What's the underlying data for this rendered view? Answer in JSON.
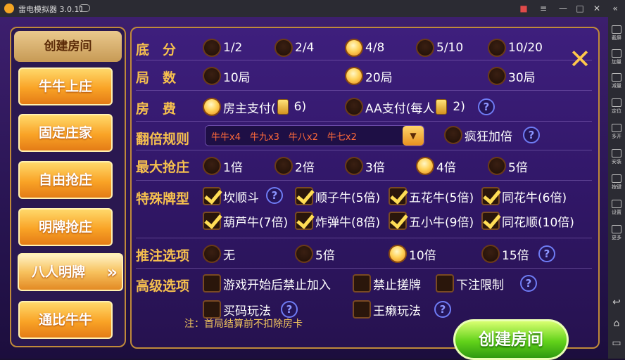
{
  "window": {
    "title": "雷电模拟器 3.0.11"
  },
  "right_sidebar": {
    "items": [
      "截屏",
      "加量",
      "减量",
      "定位",
      "多开",
      "安装",
      "按键",
      "设置",
      "更多"
    ]
  },
  "left_panel": {
    "title": "创建房间",
    "modes": [
      "牛牛上庄",
      "固定庄家",
      "自由抢庄",
      "明牌抢庄",
      "八人明牌",
      "通比牛牛"
    ],
    "active_mode": "八人明牌",
    "active_arrow": "»"
  },
  "close_glyph": "✕",
  "settings": {
    "base_score": {
      "label": "底　分",
      "options": [
        "1/2",
        "2/4",
        "4/8",
        "5/10",
        "10/20"
      ],
      "selected": "4/8"
    },
    "rounds": {
      "label": "局　数",
      "options": [
        "10局",
        "20局",
        "30局"
      ],
      "selected": "20局"
    },
    "room_fee": {
      "label": "房　费",
      "owner_pay": "房主支付(",
      "owner_cost": "6)",
      "aa_pay": "AA支付(每人",
      "aa_cost": "2)",
      "selected": "房主支付"
    },
    "double_rule": {
      "label": "翻倍规则",
      "dropdown_value": "牛牛x4　牛九x3　牛八x2　牛七x2",
      "dropdown_arrow": "▼",
      "crazy_label": "疯狂加倍"
    },
    "max_grab": {
      "label": "最大抢庄",
      "options": [
        "1倍",
        "2倍",
        "3倍",
        "4倍",
        "5倍"
      ],
      "selected": "4倍"
    },
    "special": {
      "label": "特殊牌型",
      "row1": [
        "坎顺斗",
        "顺子牛(5倍)",
        "五花牛(5倍)",
        "同花牛(6倍)"
      ],
      "row2": [
        "葫芦牛(7倍)",
        "炸弹牛(8倍)",
        "五小牛(9倍)",
        "同花顺(10倍)"
      ]
    },
    "bet": {
      "label": "推注选项",
      "options": [
        "无",
        "5倍",
        "10倍",
        "15倍"
      ],
      "selected": "10倍"
    },
    "advanced": {
      "label": "高级选项",
      "row1": [
        "游戏开始后禁止加入",
        "禁止搓牌",
        "下注限制"
      ],
      "row2": [
        "买码玩法",
        "王癞玩法"
      ]
    },
    "help_glyph": "?"
  },
  "footer": {
    "note": "注：首局结算前不扣除房卡",
    "create_button": "创建房间"
  },
  "colors": {
    "label": "#f6c04e",
    "accent_orange": "#f9a326",
    "create_green": "#62d21a"
  }
}
